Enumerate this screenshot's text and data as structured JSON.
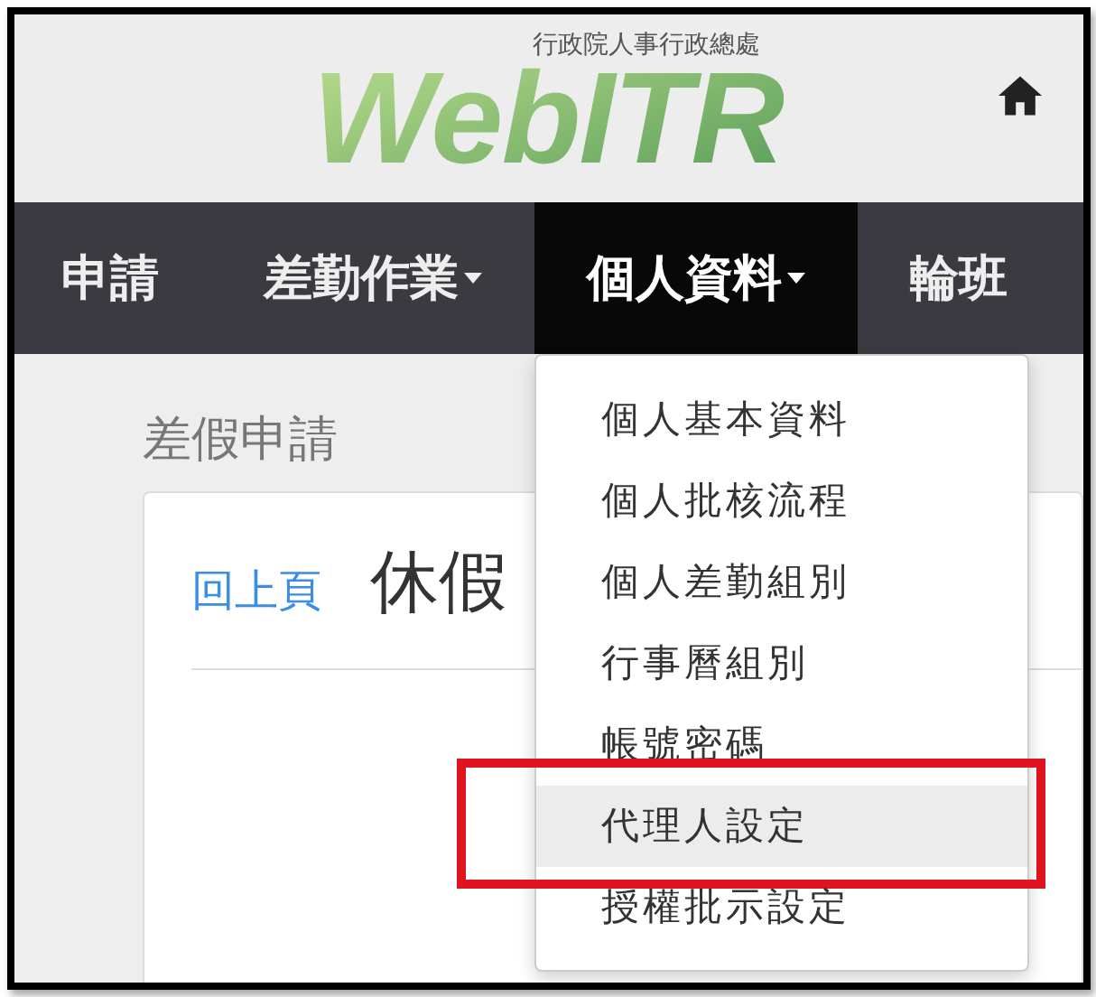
{
  "header": {
    "logo": "WebITR",
    "subtitle": "行政院人事行政總處",
    "home_icon": true
  },
  "nav": {
    "items": [
      {
        "label": "申請",
        "caret": false,
        "selected": false
      },
      {
        "label": "差勤作業",
        "caret": true,
        "selected": false
      },
      {
        "label": "個人資料",
        "caret": true,
        "selected": true
      },
      {
        "label": "輪班",
        "caret": false,
        "selected": false
      }
    ]
  },
  "menu": {
    "items": [
      {
        "label": "個人基本資料",
        "selected": false,
        "marked": false
      },
      {
        "label": "個人批核流程",
        "selected": false,
        "marked": false
      },
      {
        "label": "個人差勤組別",
        "selected": false,
        "marked": false
      },
      {
        "label": "行事曆組別",
        "selected": false,
        "marked": false
      },
      {
        "label": "帳號密碼",
        "selected": false,
        "marked": false
      },
      {
        "label": "代理人設定",
        "selected": true,
        "marked": true
      },
      {
        "label": "授權批示設定",
        "selected": false,
        "marked": false
      }
    ]
  },
  "page": {
    "title": "差假申請",
    "back_link": "回上頁",
    "heading": "休假"
  }
}
